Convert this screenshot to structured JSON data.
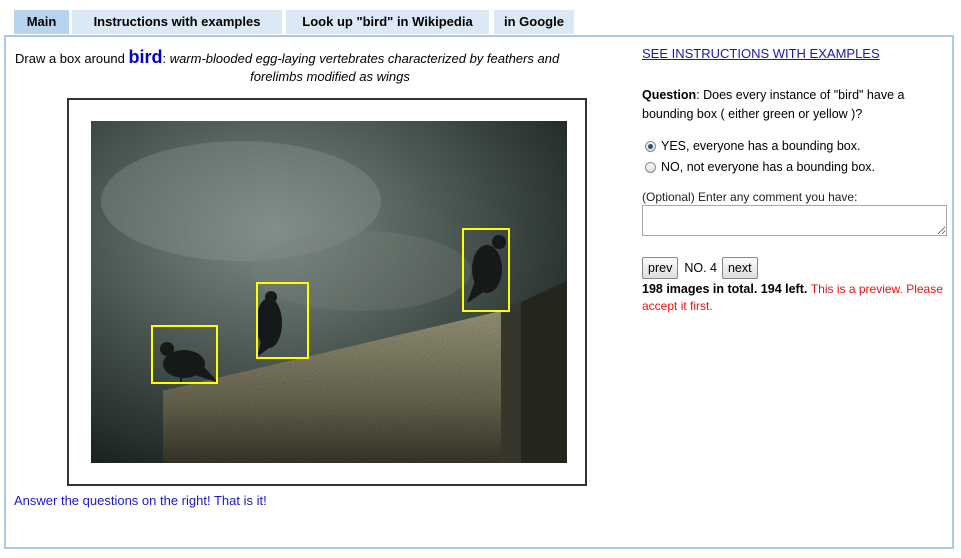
{
  "tabs": [
    {
      "label": "Main",
      "active": true
    },
    {
      "label": "Instructions with examples",
      "active": false
    },
    {
      "label": "Look up \"bird\" in Wikipedia",
      "active": false
    },
    {
      "label": "in Google",
      "active": false
    }
  ],
  "task": {
    "prefix": "Draw a box around ",
    "word": "bird",
    "colon": ": ",
    "definition_line1": "warm-blooded egg-laying vertebrates characterized by feathers and",
    "definition_line2": "forelimbs modified as wings"
  },
  "image": {
    "boxes": [
      {
        "color": "#ffff00",
        "label": "bird-1"
      },
      {
        "color": "#ffff00",
        "label": "bird-2"
      },
      {
        "color": "#ffff00",
        "label": "bird-3"
      }
    ]
  },
  "answer_note": "Answer the questions on the right! That is it!",
  "sidebar": {
    "see_instructions": "SEE INSTRUCTIONS WITH EXAMPLES",
    "question_label": "Question",
    "question_text": ": Does every instance of \"bird\" have a bounding box ( either green or yellow )?",
    "options": [
      {
        "label": "YES, everyone has a bounding box.",
        "checked": true
      },
      {
        "label": "NO, not everyone has a bounding box.",
        "checked": false
      }
    ],
    "comment_label": "(Optional) Enter any comment you have:",
    "comment_value": "",
    "prev_label": "prev",
    "no_label": "NO. 4",
    "next_label": "next",
    "count_text": "198 images in total. 194 left.",
    "preview_text": "This is a preview. Please accept it first."
  },
  "colors": {
    "tab_bg": "#dbe9f6",
    "tab_active_bg": "#b7d3ee",
    "panel_border": "#a9c9ea",
    "box_yellow": "#ffff00",
    "link_blue": "#1a1aa6",
    "warning_red": "#ee1111"
  }
}
